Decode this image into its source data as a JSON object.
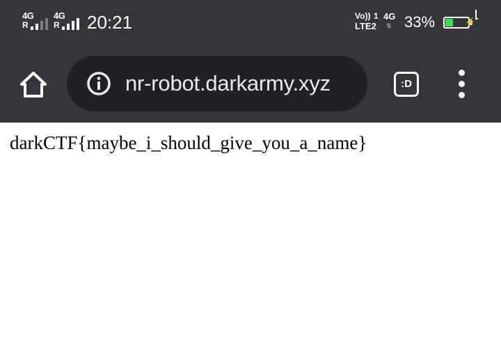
{
  "status_bar": {
    "sim1": {
      "network": "4G",
      "roaming": "R"
    },
    "sim2": {
      "network": "4G",
      "roaming": "R"
    },
    "clock": "20:21",
    "volte": {
      "top": "Vo))",
      "slot": "1",
      "bottom": "LTE2"
    },
    "data_network": "4G",
    "battery_percent": "33%",
    "battery_level": 0.33,
    "battery_color": "#3ddc5a",
    "charging": true
  },
  "browser": {
    "home_icon": "home-icon",
    "info_icon": "info-icon",
    "url": "nr-robot.darkarmy.xyz",
    "tabs_icon_label": ":D",
    "menu_icon": "more-vert-icon",
    "toolbar_color": "#35363a",
    "omnibox_color": "#202124"
  },
  "page": {
    "body_text": "darkCTF{maybe_i_should_give_you_a_name}"
  }
}
